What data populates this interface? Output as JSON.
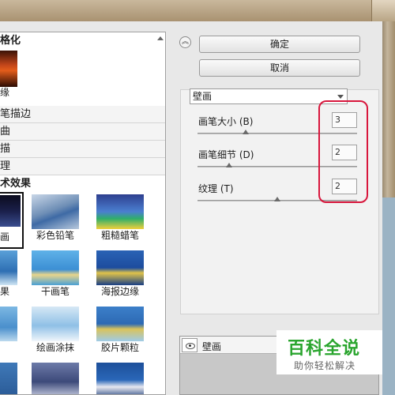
{
  "left_panel": {
    "categories": {
      "top": "格化",
      "first_thumb_label": "缘",
      "c1": "笔描边",
      "c2": "曲",
      "c3": "描",
      "c4": "理",
      "art": "术效果"
    },
    "tiles": [
      {
        "label": "彩色铅笔"
      },
      {
        "label": "粗糙蜡笔"
      },
      {
        "label": "干画笔"
      },
      {
        "label": "海报边缘"
      },
      {
        "label": "绘画涂抹"
      },
      {
        "label": "胶片颗粒"
      }
    ],
    "partial_labels": [
      "画",
      "果"
    ]
  },
  "buttons": {
    "ok": "确定",
    "cancel": "取消",
    "collapse_icon": "chevron-double-up-icon"
  },
  "filter": {
    "selected": "壁画",
    "params": [
      {
        "label": "画笔大小 (B)",
        "value": "3",
        "slider_fraction": 0.3
      },
      {
        "label": "画笔细节 (D)",
        "value": "2",
        "slider_fraction": 0.2
      },
      {
        "label": "纹理 (T)",
        "value": "2",
        "slider_fraction": 0.5
      }
    ]
  },
  "effect_layers": [
    {
      "name": "壁画",
      "visible_icon": "eye-icon"
    }
  ],
  "watermark": {
    "title": "百科全说",
    "subtitle": "助你轻松解决"
  },
  "colors": {
    "highlight": "#d8163c",
    "watermark_green": "#2aa52e"
  }
}
